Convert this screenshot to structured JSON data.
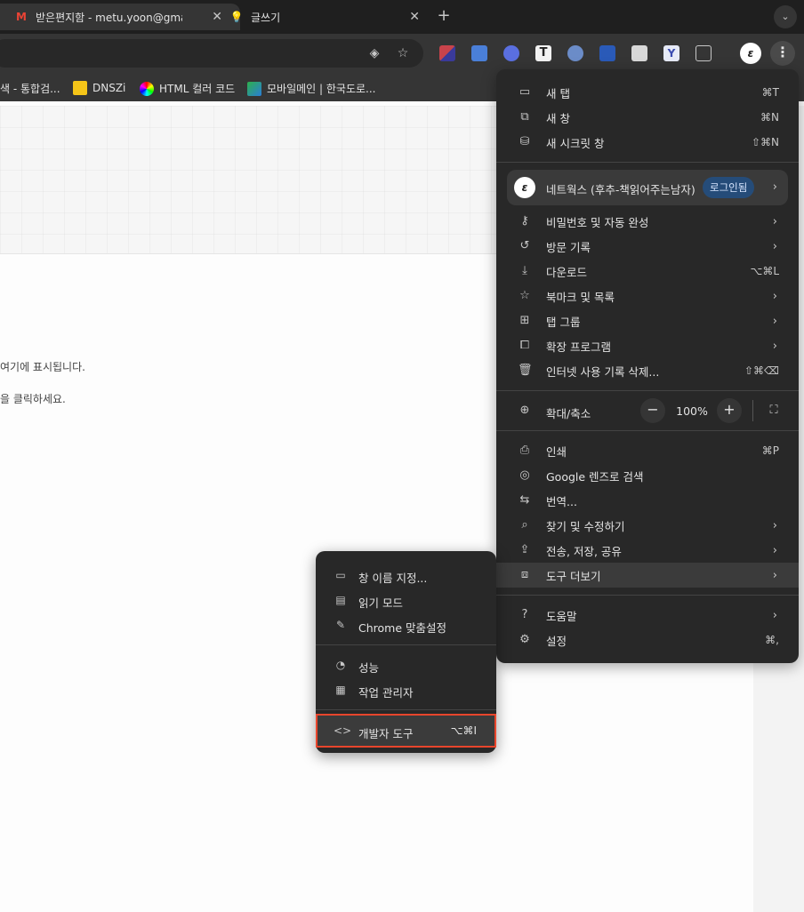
{
  "tabs": [
    {
      "title": "받은편지함 - metu.yoon@gmail",
      "icon": "gmail-icon"
    },
    {
      "title": "글쓰기",
      "icon": "lightbulb-icon"
    }
  ],
  "toolbar": {
    "more_label": "⋮",
    "profile_letter": "ε"
  },
  "bookmarks": [
    {
      "label": "색 - 통합검...",
      "color": "#3b7ddd"
    },
    {
      "label": "DNSZi",
      "color": "#f5c518"
    },
    {
      "label": "HTML 컬러 코드",
      "color": "#ffffff"
    },
    {
      "label": "모바일메인 | 한국도로...",
      "color": "#2db04b"
    }
  ],
  "page": {
    "line1": "여기에 표시됩니다.",
    "line2": "을 클릭하세요."
  },
  "menu": {
    "group1": [
      {
        "label": "새 탭",
        "shortcut": "⌘T",
        "icon": "new-tab-icon"
      },
      {
        "label": "새 창",
        "shortcut": "⌘N",
        "icon": "new-window-icon"
      },
      {
        "label": "새 시크릿 창",
        "shortcut": "⇧⌘N",
        "icon": "incognito-icon"
      }
    ],
    "profile": {
      "name": "네트웍스 (후추-책읽어주는남자)",
      "badge": "로그인됨",
      "letter": "ε"
    },
    "group2": [
      {
        "label": "비밀번호 및 자동 완성",
        "shortcut": "",
        "submenu": true,
        "icon": "key-icon"
      },
      {
        "label": "방문 기록",
        "shortcut": "",
        "submenu": true,
        "icon": "history-icon"
      },
      {
        "label": "다운로드",
        "shortcut": "⌥⌘L",
        "submenu": false,
        "icon": "download-icon"
      },
      {
        "label": "북마크 및 목록",
        "shortcut": "",
        "submenu": true,
        "icon": "star-icon"
      },
      {
        "label": "탭 그룹",
        "shortcut": "",
        "submenu": true,
        "icon": "tab-groups-icon"
      },
      {
        "label": "확장 프로그램",
        "shortcut": "",
        "submenu": true,
        "icon": "extension-icon"
      },
      {
        "label": "인터넷 사용 기록 삭제...",
        "shortcut": "⇧⌘⌫",
        "submenu": false,
        "icon": "trash-icon"
      }
    ],
    "zoom": {
      "label": "확대/축소",
      "value": "100%",
      "minus": "−",
      "plus": "+"
    },
    "group3": [
      {
        "label": "인쇄",
        "shortcut": "⌘P",
        "submenu": false,
        "icon": "print-icon"
      },
      {
        "label": "Google 렌즈로 검색",
        "shortcut": "",
        "submenu": false,
        "icon": "lens-icon"
      },
      {
        "label": "번역...",
        "shortcut": "",
        "submenu": false,
        "icon": "translate-icon"
      },
      {
        "label": "찾기 및 수정하기",
        "shortcut": "",
        "submenu": true,
        "icon": "find-icon"
      },
      {
        "label": "전송, 저장, 공유",
        "shortcut": "",
        "submenu": true,
        "icon": "share-icon"
      },
      {
        "label": "도구 더보기",
        "shortcut": "",
        "submenu": true,
        "icon": "toolbox-icon"
      }
    ],
    "group4": [
      {
        "label": "도움말",
        "shortcut": "",
        "submenu": true,
        "icon": "help-icon"
      },
      {
        "label": "설정",
        "shortcut": "⌘,",
        "submenu": false,
        "icon": "settings-icon"
      }
    ]
  },
  "submenu": {
    "items": [
      {
        "label": "창 이름 지정...",
        "shortcut": "",
        "icon": "window-name-icon"
      },
      {
        "label": "읽기 모드",
        "shortcut": "",
        "icon": "reading-mode-icon"
      },
      {
        "label": "Chrome 맞춤설정",
        "shortcut": "",
        "icon": "pencil-icon"
      },
      {
        "label": "성능",
        "shortcut": "",
        "icon": "performance-icon"
      },
      {
        "label": "작업 관리자",
        "shortcut": "",
        "icon": "task-manager-icon"
      },
      {
        "label": "개발자 도구",
        "shortcut": "⌥⌘I",
        "icon": "code-icon"
      }
    ]
  },
  "colors": {
    "highlight": "#e8452c",
    "badge": "#254c79"
  }
}
